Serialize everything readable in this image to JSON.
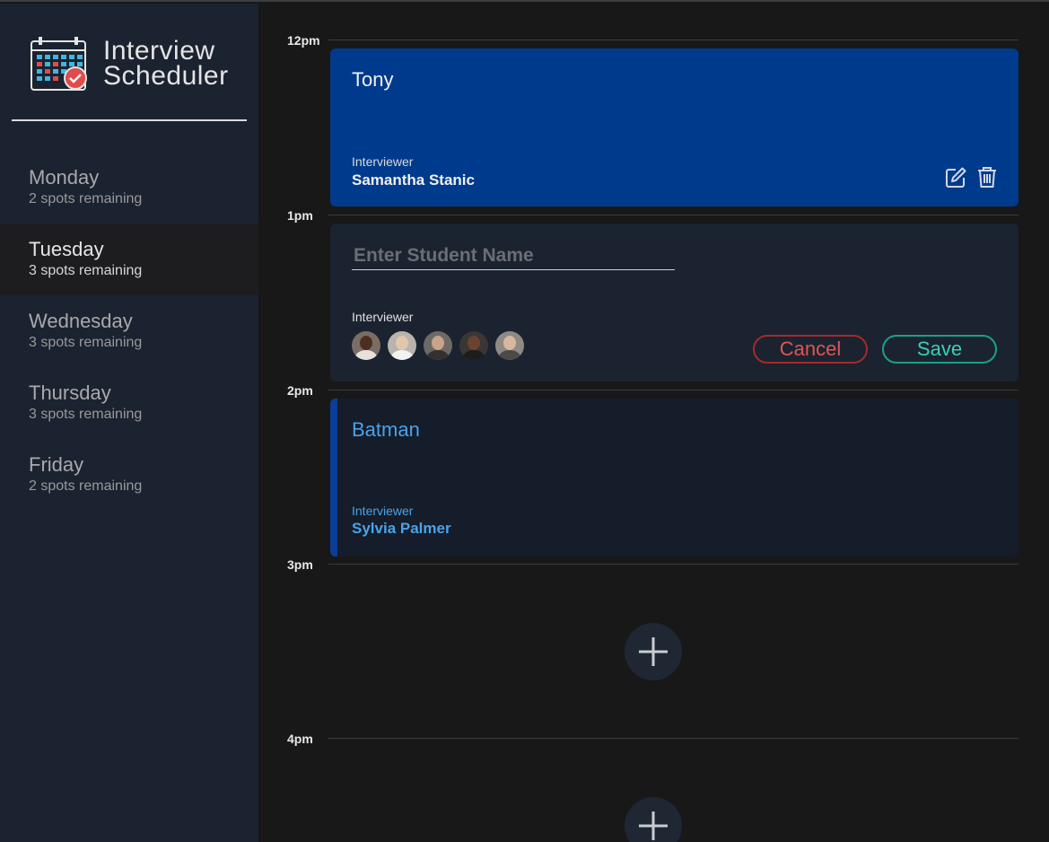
{
  "app": {
    "title_line1": "Interview",
    "title_line2": "Scheduler",
    "logo_icon": "calendar-check-icon"
  },
  "days": [
    {
      "name": "Monday",
      "spots": "2 spots remaining",
      "selected": false
    },
    {
      "name": "Tuesday",
      "spots": "3 spots remaining",
      "selected": true
    },
    {
      "name": "Wednesday",
      "spots": "3 spots remaining",
      "selected": false
    },
    {
      "name": "Thursday",
      "spots": "3 spots remaining",
      "selected": false
    },
    {
      "name": "Friday",
      "spots": "2 spots remaining",
      "selected": false
    }
  ],
  "schedule": {
    "slots": [
      {
        "time": "12pm",
        "type": "show",
        "student": "Tony",
        "interviewer_label": "Interviewer",
        "interviewer": "Samantha Stanic",
        "icons": [
          "edit-icon",
          "trash-icon"
        ]
      },
      {
        "time": "1pm",
        "type": "form",
        "student_placeholder": "Enter Student Name",
        "interviewer_label": "Interviewer",
        "avatars": [
          "interviewer-avatar-1",
          "interviewer-avatar-2",
          "interviewer-avatar-3",
          "interviewer-avatar-4",
          "interviewer-avatar-5"
        ],
        "cancel_label": "Cancel",
        "save_label": "Save"
      },
      {
        "time": "2pm",
        "type": "show-highlight",
        "student": "Batman",
        "interviewer_label": "Interviewer",
        "interviewer": "Sylvia Palmer"
      },
      {
        "time": "3pm",
        "type": "empty",
        "icon": "add-icon"
      },
      {
        "time": "4pm",
        "type": "empty",
        "icon": "add-icon"
      }
    ]
  },
  "colors": {
    "sidebar": "#1b2330",
    "selected_day": "#1d1d1f",
    "show_card": "#003a8c",
    "cancel": "#e05555",
    "save": "#3ad1b2",
    "highlight_text": "#4aa3ea"
  }
}
